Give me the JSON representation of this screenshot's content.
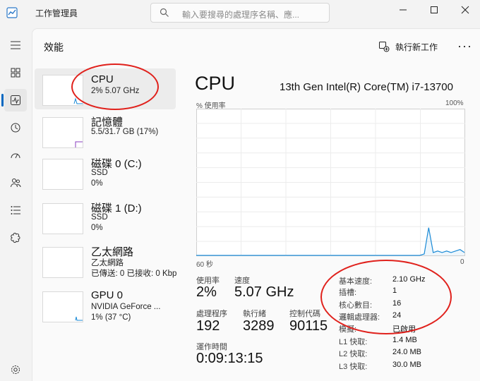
{
  "app": {
    "title": "工作管理員"
  },
  "search": {
    "placeholder": "輸入要搜尋的處理序名稱、應..."
  },
  "colors": {
    "accent": "#0067c0",
    "cpu_line": "#1a8ad6",
    "memory_line": "#8a3dbf",
    "annotation": "#e0211c"
  },
  "nav": {
    "icons": [
      "hamburger-icon",
      "processes-icon",
      "performance-icon",
      "app-history-icon",
      "startup-icon",
      "users-icon",
      "details-icon",
      "services-icon",
      "settings-icon"
    ],
    "active": "performance"
  },
  "header": {
    "title": "效能",
    "run_new_task": "執行新工作"
  },
  "resources": [
    {
      "title": "CPU",
      "line1": "2%  5.07 GHz",
      "line2": "",
      "line3": ""
    },
    {
      "title": "記憶體",
      "line1": "5.5/31.7 GB (17%)",
      "line2": "",
      "line3": ""
    },
    {
      "title": "磁碟 0 (C:)",
      "line1": "SSD",
      "line2": "0%",
      "line3": ""
    },
    {
      "title": "磁碟 1 (D:)",
      "line1": "SSD",
      "line2": "0%",
      "line3": ""
    },
    {
      "title": "乙太網路",
      "line1": "乙太網路",
      "line2": "已傳送: 0 已接收: 0 Kbp",
      "line3": ""
    },
    {
      "title": "GPU 0",
      "line1": "NVIDIA GeForce ...",
      "line2": "1% (37 °C)",
      "line3": ""
    }
  ],
  "detail": {
    "title": "CPU",
    "model": "13th Gen Intel(R) Core(TM) i7-13700",
    "graph_label": "% 使用率",
    "graph_max": "100%",
    "graph_time": "60 秒",
    "graph_min": "0",
    "usage_series": [
      0,
      0,
      0,
      0,
      0,
      0,
      0,
      0,
      0,
      0,
      0,
      0,
      0,
      0,
      0,
      0,
      0,
      0,
      0,
      0,
      0,
      0,
      0,
      0,
      0,
      0,
      0,
      0,
      0,
      0,
      0,
      0,
      0,
      0,
      0,
      0,
      0,
      0,
      0,
      0,
      0,
      0,
      0,
      0,
      0,
      0,
      0,
      0,
      0,
      0,
      0,
      1,
      19,
      2,
      3,
      2,
      3,
      2,
      3,
      4,
      2
    ],
    "utilization_label": "使用率",
    "utilization": "2%",
    "speed_label": "速度",
    "speed": "5.07 GHz",
    "processes_label": "處理程序",
    "processes": "192",
    "threads_label": "執行緒",
    "threads": "3289",
    "handles_label": "控制代碼",
    "handles": "90115",
    "uptime_label": "運作時間",
    "uptime": "0:09:13:15",
    "specs": [
      {
        "k": "基本速度:",
        "v": "2.10 GHz"
      },
      {
        "k": "插槽:",
        "v": "1"
      },
      {
        "k": "核心數目:",
        "v": "16"
      },
      {
        "k": "邏輯處理器:",
        "v": "24"
      },
      {
        "k": "模擬:",
        "v": "已啟用"
      },
      {
        "k": "L1 快取:",
        "v": "1.4 MB"
      },
      {
        "k": "L2 快取:",
        "v": "24.0 MB"
      },
      {
        "k": "L3 快取:",
        "v": "30.0 MB"
      }
    ]
  }
}
